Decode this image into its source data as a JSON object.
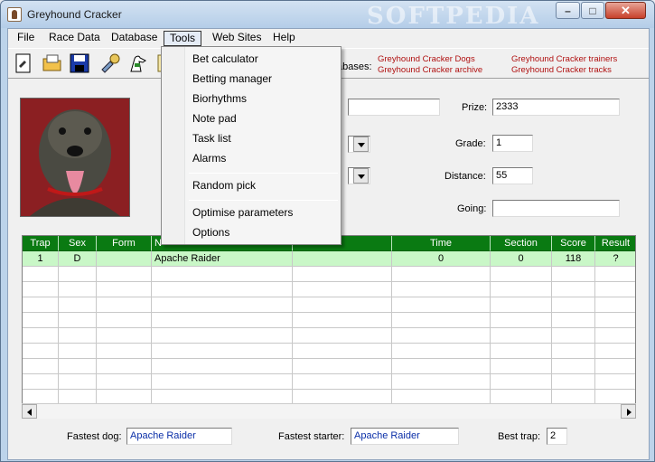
{
  "window": {
    "title": "Greyhound Cracker",
    "watermark": "SOFTPEDIA"
  },
  "menu": [
    "File",
    "Race Data",
    "Database",
    "Tools",
    "Web Sites",
    "Help"
  ],
  "tools_menu": {
    "group1": [
      "Bet calculator",
      "Betting manager",
      "Biorhythms",
      "Note pad",
      "Task list",
      "Alarms"
    ],
    "group2": [
      "Random pick"
    ],
    "group3": [
      "Optimise parameters",
      "Options"
    ]
  },
  "toolbar": {
    "icons": [
      "new-document-icon",
      "open-folder-icon",
      "save-disk-icon",
      "tools-icon",
      "greyhound-icon",
      "notes-icon"
    ]
  },
  "databases": {
    "label": "abases:",
    "links": [
      "Greyhound Cracker Dogs",
      "Greyhound Cracker archive",
      "Greyhound Cracker trainers",
      "Greyhound Cracker tracks"
    ]
  },
  "form": {
    "prize_label": "Prize:",
    "prize_value": "2333",
    "grade_label": "Grade:",
    "grade_value": "1",
    "distance_label": "Distance:",
    "distance_value": "55",
    "going_label": "Going:",
    "going_value": ""
  },
  "table": {
    "headers": [
      "Trap",
      "Sex",
      "Form",
      "N",
      "",
      "Time",
      "Section",
      "Score",
      "Result"
    ],
    "rows": [
      [
        "1",
        "D",
        "",
        "Apache Raider",
        "",
        "0",
        "0",
        "118",
        "?"
      ]
    ]
  },
  "footer": {
    "fastest_dog_label": "Fastest dog:",
    "fastest_dog_value": "Apache Raider",
    "fastest_starter_label": "Fastest starter:",
    "fastest_starter_value": "Apache Raider",
    "best_trap_label": "Best trap:",
    "best_trap_value": "2"
  }
}
